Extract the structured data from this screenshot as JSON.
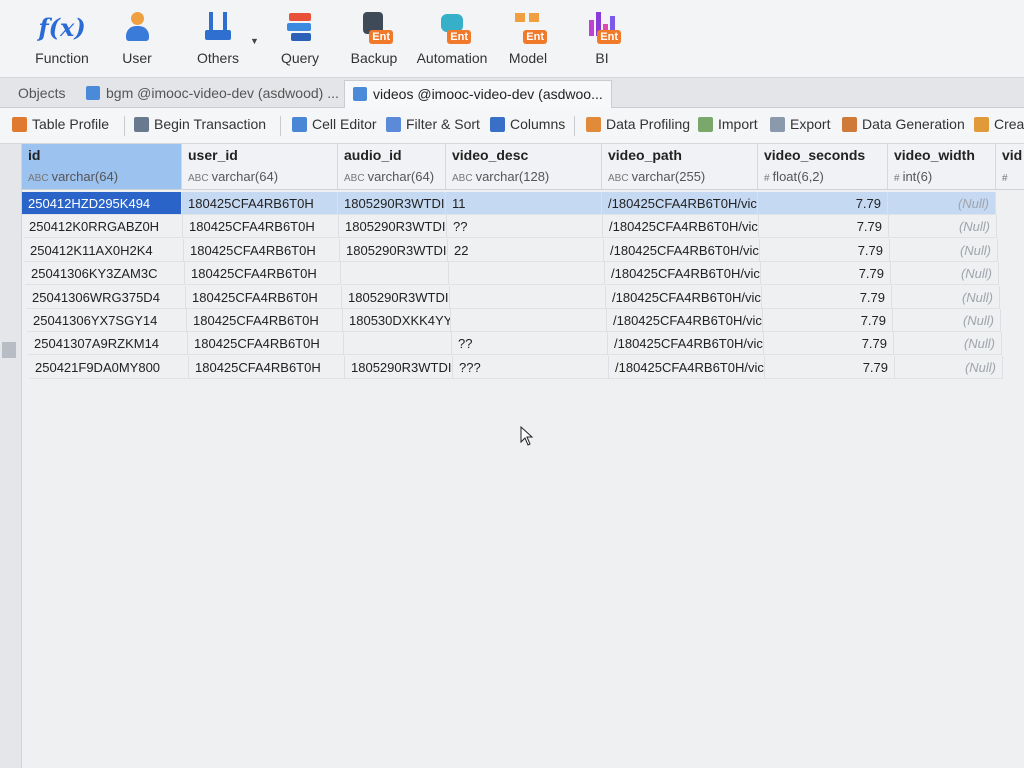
{
  "ribbon": {
    "items": [
      {
        "label": "Function"
      },
      {
        "label": "User"
      },
      {
        "label": "Others"
      },
      {
        "label": "Query"
      },
      {
        "label": "Backup",
        "badge": "Ent"
      },
      {
        "label": "Automation",
        "badge": "Ent"
      },
      {
        "label": "Model",
        "badge": "Ent"
      },
      {
        "label": "BI",
        "badge": "Ent"
      }
    ],
    "function_glyph": "f(x)"
  },
  "tabs": [
    {
      "label": "Objects"
    },
    {
      "label": "bgm @imooc-video-dev (asdwood) ..."
    },
    {
      "label": "videos @imooc-video-dev (asdwoo..."
    }
  ],
  "actions": [
    {
      "label": "Table Profile",
      "icon": "table-profile-icon"
    },
    {
      "label": "Begin Transaction",
      "icon": "transaction-icon"
    },
    {
      "label": "Cell Editor",
      "icon": "cell-editor-icon"
    },
    {
      "label": "Filter & Sort",
      "icon": "filter-icon"
    },
    {
      "label": "Columns",
      "icon": "columns-icon"
    },
    {
      "label": "Data Profiling",
      "icon": "data-profiling-icon"
    },
    {
      "label": "Import",
      "icon": "import-icon"
    },
    {
      "label": "Export",
      "icon": "export-icon"
    },
    {
      "label": "Data Generation",
      "icon": "data-generation-icon"
    },
    {
      "label": "Creat",
      "icon": "create-icon"
    }
  ],
  "columns": [
    {
      "name": "id",
      "type": "varchar(64)",
      "type_icon": "ABC"
    },
    {
      "name": "user_id",
      "type": "varchar(64)",
      "type_icon": "ABC"
    },
    {
      "name": "audio_id",
      "type": "varchar(64)",
      "type_icon": "ABC"
    },
    {
      "name": "video_desc",
      "type": "varchar(128)",
      "type_icon": "ABC"
    },
    {
      "name": "video_path",
      "type": "varchar(255)",
      "type_icon": "ABC"
    },
    {
      "name": "video_seconds",
      "type": "float(6,2)",
      "type_icon": "#"
    },
    {
      "name": "video_width",
      "type": "int(6)",
      "type_icon": "#"
    },
    {
      "name": "vid",
      "type": "",
      "type_icon": "#"
    }
  ],
  "rows": [
    [
      "250412HZD295K494",
      "180425CFA4RB6T0H",
      "1805290R3WTDI",
      "11",
      "/180425CFA4RB6T0H/vic",
      "7.79",
      "(Null)"
    ],
    [
      "250412K0RRGABZ0H",
      "180425CFA4RB6T0H",
      "1805290R3WTDI",
      "??",
      "/180425CFA4RB6T0H/vic",
      "7.79",
      "(Null)"
    ],
    [
      "250412K11AX0H2K4",
      "180425CFA4RB6T0H",
      "1805290R3WTDI",
      "22",
      "/180425CFA4RB6T0H/vic",
      "7.79",
      "(Null)"
    ],
    [
      "25041306KY3ZAM3C",
      "180425CFA4RB6T0H",
      "",
      "",
      "/180425CFA4RB6T0H/vic",
      "7.79",
      "(Null)"
    ],
    [
      "25041306WRG375D4",
      "180425CFA4RB6T0H",
      "1805290R3WTDI",
      "",
      "/180425CFA4RB6T0H/vic",
      "7.79",
      "(Null)"
    ],
    [
      "25041306YX7SGY14",
      "180425CFA4RB6T0H",
      "180530DXKK4YY",
      "",
      "/180425CFA4RB6T0H/vic",
      "7.79",
      "(Null)"
    ],
    [
      "25041307A9RZKM14",
      "180425CFA4RB6T0H",
      "",
      "??",
      "/180425CFA4RB6T0H/vic",
      "7.79",
      "(Null)"
    ],
    [
      "250421F9DA0MY800",
      "180425CFA4RB6T0H",
      "1805290R3WTDI",
      "???",
      "/180425CFA4RB6T0H/vic",
      "7.79",
      "(Null)"
    ]
  ],
  "selected_row": 0,
  "colors": {
    "selection": "#2a64c8",
    "row_highlight": "#c5d9f2",
    "header_selected": "#9cc2ef"
  }
}
